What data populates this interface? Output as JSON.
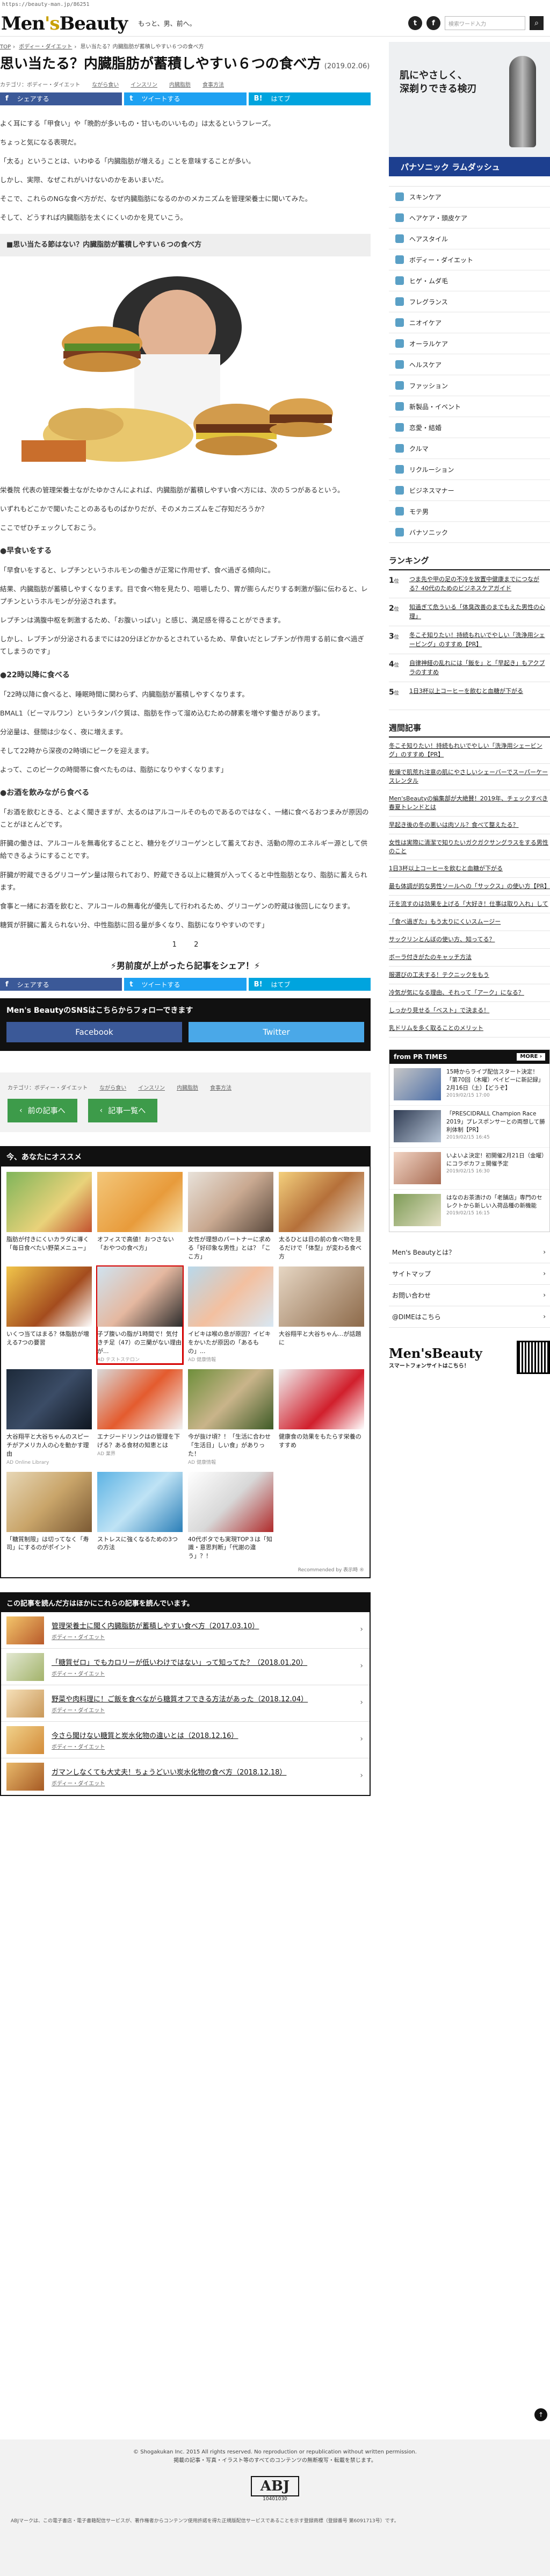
{
  "url": "https://beauty-man.jp/86251",
  "header": {
    "logo_a": "Men",
    "logo_amp": "'s",
    "logo_b": "Beauty",
    "tagline": "もっと、男、前へ。",
    "twitter_glyph": "t",
    "facebook_glyph": "f",
    "search_placeholder": "検索ワード入力",
    "search_glyph": "⌕"
  },
  "breadcrumb": [
    "TOP",
    "ボディー・ダイエット",
    "思い当たる？内臓脂肪が蓄積しやすい６つの食べ方"
  ],
  "article": {
    "title": "思い当たる？内臓脂肪が蓄積しやすい６つの食べ方",
    "date": "(2019.02.06)",
    "category": "カテゴリ：ボディー・ダイエット",
    "tags": [
      "ながら食い",
      "インスリン",
      "内臓脂肪",
      "食事方法"
    ],
    "share": {
      "fb": "シェアする",
      "tw": "ツイートする",
      "hb": "はてブ",
      "fb_glyph": "f",
      "tw_glyph": "t",
      "hb_glyph": "B!"
    },
    "intro": [
      "よく耳にする「甲食い」や「晩酌が多いもの・甘いものいいもの」は太るというフレーズ。",
      "ちょっと気になる表現だ。",
      "「太る」ということは、いわゆる「内臓脂肪が増える」ことを意味することが多い。",
      "しかし、実際、なぜこれがいけないのかをあいまいだ。",
      "そこで、これらのNGな食べ方がだ、なぜ内臓脂肪になるのかのメカニズムを管理栄養士に聞いてみた。",
      "そして、どうすれば内臓脂肪を太くにくいのかを見ていこう。"
    ],
    "h2": "■思い当たる節はない？内臓脂肪が蓄積しやすい６つの食べ方",
    "after_image": [
      "栄養院 代表の管理栄養士ながたゆかさんによれば、内臓脂肪が蓄積しやすい食べ方には、次の５つがあるという。",
      "いずれもどこかで聞いたことのあるものばかりだが、そのメカニズムをご存知だろうか？",
      "ここでぜひチェックしておこう。"
    ],
    "s1_title": "●早食いをする",
    "s1": [
      "「早食いをすると、レプチンというホルモンの働きが正常に作用せず、食べ過ぎる傾向に。",
      "結果、内臓脂肪が蓄積しやすくなります。目で食べ物を見たり、咀嚼したり、胃が膨らんだりする刺激が脳に伝わると、レプチンというホルモンが分泌されます。",
      "レプチンは満腹中枢を刺激するため、「お腹いっぱい」と感じ、満足感を得ることができます。",
      "しかし、レプチンが分泌されるまでには20分ほどかかるとされているため、早食いだとレプチンが作用する前に食べ過ぎてしまうのです」"
    ],
    "s2_title": "●22時以降に食べる",
    "s2": [
      "「22時以降に食べると、睡眠時間に関わらず、内臓脂肪が蓄積しやすくなります。",
      "BMAL1（ビーマルワン）というタンパク質は、脂肪を作って溜め込むための酵素を増やす働きがあります。",
      "分泌量は、昼間は少なく、夜に増えます。",
      "そして22時から深夜の2時頃にピークを迎えます。",
      "よって、このピークの時間帯に食べたものは、脂肪になりやすくなります」"
    ],
    "s3_title": "●お酒を飲みながら食べる",
    "s3": [
      "「お酒を飲むときる、とよく聞きますが、太るのはアルコールそのものであるのではなく、一緒に食べるおつまみが原因のことがほとんどです。",
      "肝臓の働きは、アルコールを無毒化することと、糖分をグリコーゲンとして蓄えておき、活動の際のエネルギー源として供給できるようにすることです。",
      "肝臓が貯蔵できるグリコーゲン量は限られており、貯蔵できる以上に糖質が入ってくると中性脂肪となり、脂肪に蓄えられます。",
      "食事と一緒にお酒を飲むと、アルコールの無毒化が優先して行われるため、グリコーゲンの貯蔵は後回しになります。",
      "糖質が肝臓に蓄えられない分、中性脂肪に回る量が多くなり、脂肪になりやすいのです」"
    ],
    "pager": [
      "1",
      "2"
    ],
    "share_cta": "⚡男前度が上がったら記事をシェア！⚡"
  },
  "follow": {
    "title": "Men's BeautyのSNSはこちらからフォローできます",
    "fb": "Facebook",
    "tw": "Twitter"
  },
  "bottom_meta": {
    "category": "カテゴリ：ボディー・ダイエット",
    "tags": [
      "ながら食い",
      "インスリン",
      "内臓脂肪",
      "食事方法"
    ],
    "prev": "前の記事へ",
    "list": "記事一覧へ"
  },
  "recommend": {
    "title": "今、あなたにオススメ",
    "items": [
      {
        "text": "脂肪が付きにくいカラダに導く「毎日食べたい野菜メニュー」",
        "ad": ""
      },
      {
        "text": "オフィスで高値！おつさない「おやつの食べ方」",
        "ad": ""
      },
      {
        "text": "女性が理想のパートナーに求める「好印象な男性」とは？「ここ方」",
        "ad": ""
      },
      {
        "text": "太るひとは目の前の食べ物を見るだけで「体型」が変わる食べ方",
        "ad": ""
      },
      {
        "text": "いくつ当てはまる？体脂肪が増える7つの要習",
        "ad": ""
      },
      {
        "text": "子ブ腹いの脂が1時間で！気付きチ足（47）の三蘭がない理由が...",
        "ad": "AD テストステロン"
      },
      {
        "text": "イビキは喉の息が原因？イビキをかいたが原因の「あるもの」...",
        "ad": "AD 健康情報"
      },
      {
        "text": "大谷翔平と大谷ちゃん...が話題に",
        "ad": ""
      },
      {
        "text": "大谷翔平と大谷ちゃんのスピーチがアメリカ人の心を動かす理由",
        "ad": "AD Online Library"
      },
      {
        "text": "エナジードリンクはの管理を下げる？ある食材の知恵とは",
        "ad": "AD 業界"
      },
      {
        "text": "今が抜け頃？！「生活に合わせ「生活日」しい食」がありった！",
        "ad": "AD 健康情報"
      },
      {
        "text": "健康食の効果をもたらす栄養のすすめ",
        "ad": ""
      },
      {
        "text": "「糖質制限」は切ってなく「寿司」にするのがポイント",
        "ad": ""
      },
      {
        "text": "ストレスに強くなるための3つの方法",
        "ad": ""
      },
      {
        "text": "40代ボタでも実現TOP３は「知識・意思判断」「代謝の違う」？！",
        "ad": ""
      },
      {
        "text": "",
        "ad": ""
      }
    ],
    "powered": "Recommended by 表示時 ®"
  },
  "related": {
    "title": "この記事を読んだ方はほかにこれらの記事を読んでいます。",
    "items": [
      {
        "title": "管理栄養士に聞く内臓脂肪が蓄積しやすい食べ方（2017.03.10）",
        "cat": "ボディー・ダイエット"
      },
      {
        "title": "「糖質ゼロ」でもカロリーが低いわけではない」って知ってた？（2018.01.20）",
        "cat": "ボディー・ダイエット"
      },
      {
        "title": "野菜や肉料理に！ご飯を食べながら糖質オフできる方法があった（2018.12.04）",
        "cat": "ボディー・ダイエット"
      },
      {
        "title": "今さら聞けない糖質と炭水化物の違いとは（2018.12.16）",
        "cat": "ボディー・ダイエット"
      },
      {
        "title": "ガマンしなくても大丈夫！ちょうどいい炭水化物の食べ方（2018.12.18）",
        "cat": "ボディー・ダイエット"
      }
    ]
  },
  "sidebar": {
    "ad": {
      "line1": "肌にやさしく、",
      "line2": "深剃りできる検刃",
      "brand": "パナソニック ラムダッシュ"
    },
    "categories": [
      "スキンケア",
      "ヘアケア・頭皮ケア",
      "ヘアスタイル",
      "ボディー・ダイエット",
      "ヒゲ・ムダ毛",
      "フレグランス",
      "ニオイケア",
      "オーラルケア",
      "ヘルスケア",
      "ファッション",
      "新製品・イベント",
      "恋愛・結婚",
      "クルマ",
      "リクルーション",
      "ビジネスマナー",
      "モテ男",
      "バナソニック"
    ],
    "ranking_title": "ランキング",
    "ranking": [
      {
        "no": "1",
        "suffix": "位",
        "text": "つま先や甲の足の不冷を放置中健康までにつながる？40代のためのビジネスケアガイド"
      },
      {
        "no": "2",
        "suffix": "位",
        "text": "知過ぎて危ういる「体臭改善のまでもえた男性の心理」"
      },
      {
        "no": "3",
        "suffix": "位",
        "text": "冬こそ知りたい！持続もれいでやしい「洗浄用シェービング」のすすめ【PR】"
      },
      {
        "no": "4",
        "suffix": "位",
        "text": "自律神経の乱れには「飯を」と「早起き」もアクブラのすすめ"
      },
      {
        "no": "5",
        "suffix": "位",
        "text": "1日3杯以上コーヒーを飲むと血糖が下がる"
      }
    ],
    "new_title": "週間記事",
    "new_items": [
      "冬こそ知りたい！持続もれいでやしい「洗浄用シェービング」のすすめ【PR】",
      "乾燥で肌荒れ注意の肌にやさしいシェーバーでスーパーケースレンタル",
      "Men'sBeautyの編集部が大絶賛！2019年、チェックすべき春夏トレンドとは",
      "早起き後の冬の悪いは肉ソル？食べて整えたる？",
      "女性は実際に清潔で知りたいガクガクサングラスをする男性のこと",
      "1日3杯以上コーヒーを飲むと血糖が下がる",
      "最も体調が的な男性ソールヘの「サックス」の使い方【PR】",
      "汗を流すのは効果を上げる「大好き！仕事は取り入れ」して",
      "「食べ過ぎた」もう太りにくいスムージー",
      "サックリンとんぼの使い方、知ってる？",
      "ボーラ付きがたのキャッチ方法",
      "服選びの工夫する！テクニックをもう",
      "冷気が気になる理由、それって「アーク」になる？",
      "しっかり見せる「ベスト」で決まる！",
      "乳ドリムを多く取ることのメリット"
    ],
    "prt_title": "from PR TIMES",
    "prt_more": "MORE ›",
    "prt_items": [
      {
        "text": "15時からライブ配信スタート決定！「第70回（木曜）ペイビーに新記録」2月16日（土）【どうぞ】",
        "date": "2019/02/15 17:00"
      },
      {
        "text": "「PRESCIDRALL Champion Race 2019」プレスポンサーとの両想して勝利体制【PR】",
        "date": "2019/02/15 16:45"
      },
      {
        "text": "いよいよ決定！初開催2月21日（金曜）にコラボカフェ開催予定",
        "date": "2019/02/15 16:30"
      },
      {
        "text": "はなのお茶漬けの「老舗店」専門のセレクトから新しい入荷品種の新機能",
        "date": "2019/02/15 16:15"
      }
    ],
    "links": [
      "Men's Beautyとは？",
      "サイトマップ",
      "お問い合わせ",
      "@DIMEはこちら"
    ],
    "app_line1": "Men'sBeauty",
    "app_line2": "スマートフォンサイトはこちら！"
  },
  "footer": {
    "copy1": "© Shogakukan Inc. 2015  All rights reserved. No reproduction or republication without written permission.",
    "copy2": "掲載の記事・写真・イラスト等のすべてのコンテンツの無断複写・転載を禁じます。",
    "abj": "ABJ",
    "abj_no": "10401030",
    "note": "ABJマークは、この電子書店・電子書籍配信サービスが、著作権者からコンテンツ使用許諾を得た正規版配信サービスであることを示す登録商標（登録番号 第6091713号）です。"
  },
  "pagetop_glyph": "↑",
  "colors": {
    "facebook": "#3b5998",
    "twitter": "#1da1f2",
    "hatena": "#00a4de",
    "green": "#3d9b4a"
  }
}
